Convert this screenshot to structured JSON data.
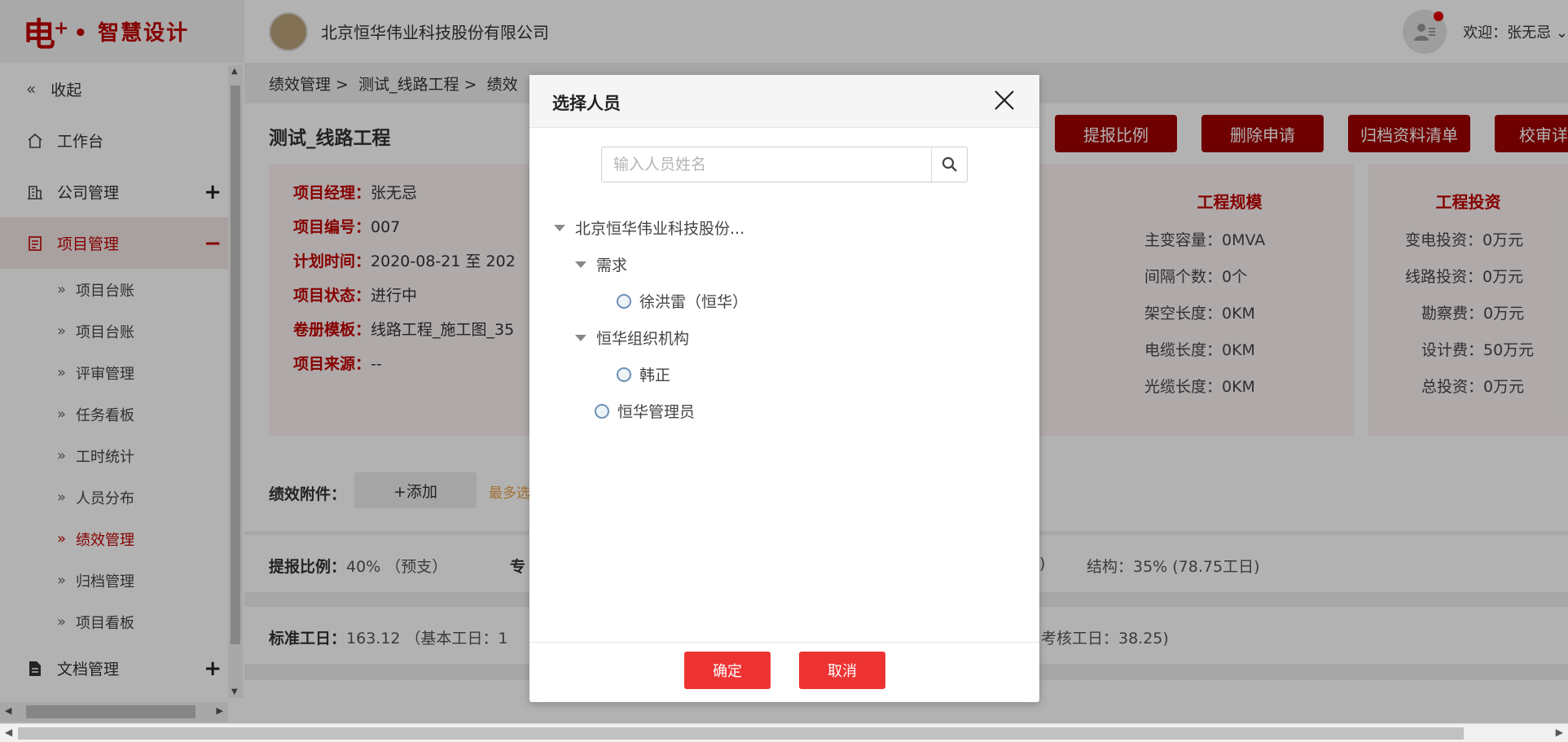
{
  "logo": {
    "mark": "电",
    "sup": "+",
    "text": "• 智慧设计"
  },
  "header": {
    "company": "北京恒华伟业科技股份有限公司",
    "welcome": "欢迎：张无忌 ⌄"
  },
  "sidebar": {
    "collapse_label": "收起",
    "items": [
      {
        "label": "工作台",
        "icon": "home-icon"
      },
      {
        "label": "公司管理",
        "icon": "building-icon",
        "toggle": "+"
      },
      {
        "label": "项目管理",
        "icon": "project-icon",
        "toggle": "−"
      }
    ],
    "subitems": [
      "项目台账",
      "项目台账",
      "评审管理",
      "任务看板",
      "工时统计",
      "人员分布",
      "绩效管理",
      "归档管理",
      "项目看板"
    ],
    "docs": {
      "label": "文档管理",
      "toggle": "+"
    }
  },
  "breadcrumb": [
    "绩效管理 >",
    "测试_线路工程 >",
    "绩效"
  ],
  "page_title": "测试_线路工程",
  "actions": [
    "提报比例",
    "删除申请",
    "归档资料清单",
    "校审详"
  ],
  "project_info": [
    {
      "label": "项目经理：",
      "value": "张无忌"
    },
    {
      "label": "项目编号：",
      "value": "007"
    },
    {
      "label": "计划时间：",
      "value": "2020-08-21 至 202"
    },
    {
      "label": "项目状态：",
      "value": "进行中"
    },
    {
      "label": "卷册模板：",
      "value": "线路工程_施工图_35"
    },
    {
      "label": "项目来源：",
      "value": "--"
    }
  ],
  "scale": {
    "title": "工程规模",
    "rows": [
      "主变容量：0MVA",
      "间隔个数：0个",
      "架空长度：0KM",
      "电缆长度：0KM",
      "光缆长度：0KM"
    ]
  },
  "investment": {
    "title": "工程投资",
    "rows": [
      "变电投资：0万元",
      "线路投资：0万元",
      "勘察费：0万元",
      "设计费：50万元",
      "总投资：0万元"
    ]
  },
  "attachments": {
    "label": "绩效附件：",
    "add": "+添加",
    "hint": "最多选"
  },
  "ratio": {
    "label": "提报比例：",
    "value": "40% （预支）",
    "spec": "专",
    "paren": ")",
    "struct": "结构：35% (78.75工日)"
  },
  "workday": {
    "label": "标准工日：",
    "value": "163.12 （基本工日：1",
    "assess": "考核工日：38.25)"
  },
  "modal": {
    "title": "选择人员",
    "search_placeholder": "输入人员姓名",
    "tree": {
      "root": "北京恒华伟业科技股份...",
      "group1": "需求",
      "person1": "徐洪雷（恒华）",
      "group2": "恒华组织机构",
      "person2": "韩正",
      "person3": "恒华管理员"
    },
    "confirm": "确定",
    "cancel": "取消"
  }
}
